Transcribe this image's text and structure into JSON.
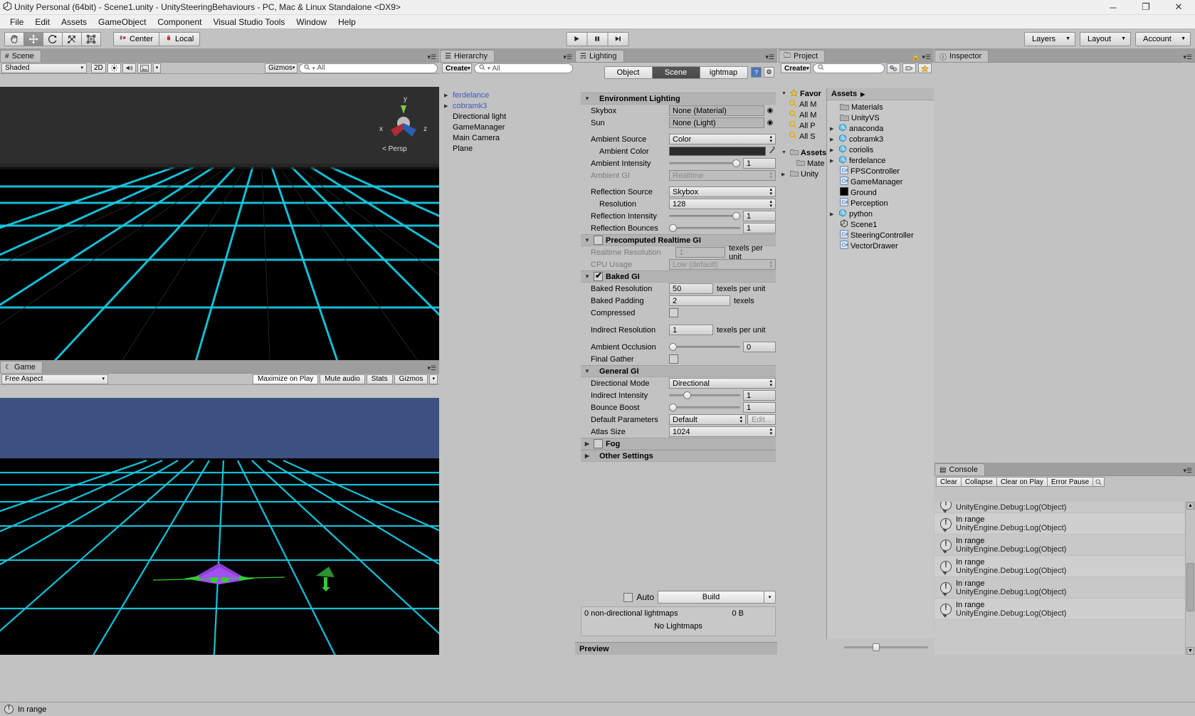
{
  "window": {
    "title": "Unity Personal (64bit) - Scene1.unity - UnitySteeringBehaviours - PC, Mac & Linux Standalone <DX9>",
    "app_icon": "unity-logo-icon",
    "minimize": "─",
    "maximize": "❐",
    "close": "✕"
  },
  "menu": [
    "File",
    "Edit",
    "Assets",
    "GameObject",
    "Component",
    "Visual Studio Tools",
    "Window",
    "Help"
  ],
  "toolbar": {
    "tools": [
      "hand-tool",
      "move-tool",
      "rotate-tool",
      "scale-tool",
      "rect-tool"
    ],
    "active_tool_index": 1,
    "pivot_label": "Center",
    "space_label": "Local",
    "play": "play-icon",
    "pause": "pause-icon",
    "step": "step-icon",
    "layers_label": "Layers",
    "layout_label": "Layout",
    "account_label": "Account"
  },
  "scene": {
    "tab": "Scene",
    "tab_icon": "scene-grid-icon",
    "shading_mode": "Shaded",
    "toggle_2d": "2D",
    "light_icon": "lighting-toggle-icon",
    "audio_icon": "audio-toggle-icon",
    "fx_icon": "effects-toggle-icon",
    "gizmos_label": "Gizmos",
    "search_placeholder": "All",
    "search_value": "",
    "axis_labels": {
      "x": "x",
      "y": "y",
      "z": "z"
    },
    "persp_label": "Persp"
  },
  "game": {
    "tab": "Game",
    "tab_icon": "game-pad-icon",
    "aspect": "Free Aspect",
    "maximize_on_play": "Maximize on Play",
    "mute_audio": "Mute audio",
    "stats": "Stats",
    "gizmos": "Gizmos"
  },
  "hierarchy": {
    "tab": "Hierarchy",
    "tab_icon": "hierarchy-icon",
    "create_label": "Create",
    "search_placeholder": "All",
    "items": [
      {
        "label": "ferdelance",
        "expandable": true,
        "prefab": true
      },
      {
        "label": "cobramk3",
        "expandable": true,
        "prefab": true
      },
      {
        "label": "Directional light",
        "expandable": false,
        "prefab": false
      },
      {
        "label": "GameManager",
        "expandable": false,
        "prefab": false
      },
      {
        "label": "Main Camera",
        "expandable": false,
        "prefab": false
      },
      {
        "label": "Plane",
        "expandable": false,
        "prefab": false
      }
    ]
  },
  "lighting": {
    "tab": "Lighting",
    "tab_icon": "lighting-icon",
    "tabs": [
      {
        "label": "Object",
        "active": false
      },
      {
        "label": "Scene",
        "active": true
      },
      {
        "label": "ightmap",
        "active": false
      }
    ],
    "help_icon": "help-book-icon",
    "settings_icon": "gear-icon",
    "sections": {
      "environment": {
        "title": "Environment Lighting",
        "skybox_label": "Skybox",
        "skybox_value": "None (Material)",
        "sun_label": "Sun",
        "sun_value": "None (Light)",
        "ambient_source_label": "Ambient Source",
        "ambient_source_value": "Color",
        "ambient_color_label": "Ambient Color",
        "ambient_color_hex": "#2b2b2b",
        "ambient_intensity_label": "Ambient Intensity",
        "ambient_intensity_value": "1",
        "ambient_gi_label": "Ambient GI",
        "ambient_gi_value": "Realtime",
        "reflection_source_label": "Reflection Source",
        "reflection_source_value": "Skybox",
        "resolution_label": "Resolution",
        "resolution_value": "128",
        "reflection_intensity_label": "Reflection Intensity",
        "reflection_intensity_value": "1",
        "reflection_bounces_label": "Reflection Bounces",
        "reflection_bounces_value": "1"
      },
      "precomputed": {
        "title": "Precomputed Realtime GI",
        "enabled": false,
        "realtime_resolution_label": "Realtime Resolution",
        "realtime_resolution_value": "1",
        "realtime_resolution_unit": "texels per unit",
        "cpu_usage_label": "CPU Usage",
        "cpu_usage_value": "Low (default)"
      },
      "baked": {
        "title": "Baked GI",
        "enabled": true,
        "baked_resolution_label": "Baked Resolution",
        "baked_resolution_value": "50",
        "baked_resolution_unit": "texels per unit",
        "baked_padding_label": "Baked Padding",
        "baked_padding_value": "2",
        "baked_padding_unit": "texels",
        "compressed_label": "Compressed",
        "compressed_checked": false,
        "indirect_resolution_label": "Indirect Resolution",
        "indirect_resolution_value": "1",
        "indirect_resolution_unit": "texels per unit",
        "ambient_occlusion_label": "Ambient Occlusion",
        "ambient_occlusion_value": "0",
        "final_gather_label": "Final Gather",
        "final_gather_checked": false
      },
      "general": {
        "title": "General GI",
        "directional_mode_label": "Directional Mode",
        "directional_mode_value": "Directional",
        "indirect_intensity_label": "Indirect Intensity",
        "indirect_intensity_value": "1",
        "bounce_boost_label": "Bounce Boost",
        "bounce_boost_value": "1",
        "default_parameters_label": "Default Parameters",
        "default_parameters_value": "Default",
        "edit_label": "Edit...",
        "atlas_size_label": "Atlas Size",
        "atlas_size_value": "1024"
      },
      "fog": {
        "title": "Fog",
        "enabled": false
      },
      "other": {
        "title": "Other Settings"
      }
    },
    "auto_label": "Auto",
    "auto_checked": false,
    "build_label": "Build",
    "stats_line1": "0 non-directional lightmaps",
    "stats_size": "0 B",
    "stats_line2": "No Lightmaps",
    "preview_label": "Preview"
  },
  "project": {
    "tab": "Project",
    "tab_icon": "folder-icon",
    "create_label": "Create",
    "search_placeholder": "",
    "lock_icon": "lock-icon",
    "favorites": {
      "label": "Favor",
      "items": [
        "All M",
        "All M",
        "All P",
        "All S"
      ]
    },
    "assets_tree_label": "Assets",
    "tree_children": [
      {
        "label": "Mate",
        "expandable": false
      },
      {
        "label": "Unity",
        "expandable": true
      }
    ],
    "breadcrumb": "Assets",
    "files": [
      {
        "label": "Materials",
        "icon": "folder-icon",
        "expandable": false
      },
      {
        "label": "UnityVS",
        "icon": "folder-icon",
        "expandable": false
      },
      {
        "label": "anaconda",
        "icon": "prefab-icon",
        "expandable": true
      },
      {
        "label": "cobramk3",
        "icon": "prefab-icon",
        "expandable": true
      },
      {
        "label": "coriolis",
        "icon": "prefab-icon",
        "expandable": true
      },
      {
        "label": "ferdelance",
        "icon": "prefab-icon",
        "expandable": true
      },
      {
        "label": "FPSController",
        "icon": "script-icon",
        "expandable": false
      },
      {
        "label": "GameManager",
        "icon": "script-icon",
        "expandable": false
      },
      {
        "label": "Ground",
        "icon": "material-icon",
        "expandable": false
      },
      {
        "label": "Perception",
        "icon": "script-icon",
        "expandable": false
      },
      {
        "label": "python",
        "icon": "prefab-icon",
        "expandable": true
      },
      {
        "label": "Scene1",
        "icon": "unity-scene-icon",
        "expandable": false
      },
      {
        "label": "SteeringController",
        "icon": "script-icon",
        "expandable": false
      },
      {
        "label": "VectorDrawer",
        "icon": "script-icon",
        "expandable": false
      }
    ]
  },
  "inspector": {
    "tab": "Inspector",
    "tab_icon": "info-icon"
  },
  "console": {
    "tab": "Console",
    "tab_icon": "console-icon",
    "buttons": [
      "Clear",
      "Collapse",
      "Clear on Play",
      "Error Pause"
    ],
    "entries": [
      {
        "line1": "",
        "line2": "UnityEngine.Debug:Log(Object)",
        "partial": true
      },
      {
        "line1": "In range",
        "line2": "UnityEngine.Debug:Log(Object)",
        "partial": false
      },
      {
        "line1": "In range",
        "line2": "UnityEngine.Debug:Log(Object)",
        "partial": false
      },
      {
        "line1": "In range",
        "line2": "UnityEngine.Debug:Log(Object)",
        "partial": false
      },
      {
        "line1": "In range",
        "line2": "UnityEngine.Debug:Log(Object)",
        "partial": false
      },
      {
        "line1": "In range",
        "line2": "UnityEngine.Debug:Log(Object)",
        "partial": false
      }
    ]
  },
  "status": {
    "icon": "warning-icon",
    "text": "In range"
  },
  "colors": {
    "chrome": "#c2c2c2",
    "tabstrip": "#9e9e9e",
    "grid_cyan": "#18c8e0",
    "game_sky": "#3c5182",
    "prefab_blue": "#3b5bb5"
  }
}
